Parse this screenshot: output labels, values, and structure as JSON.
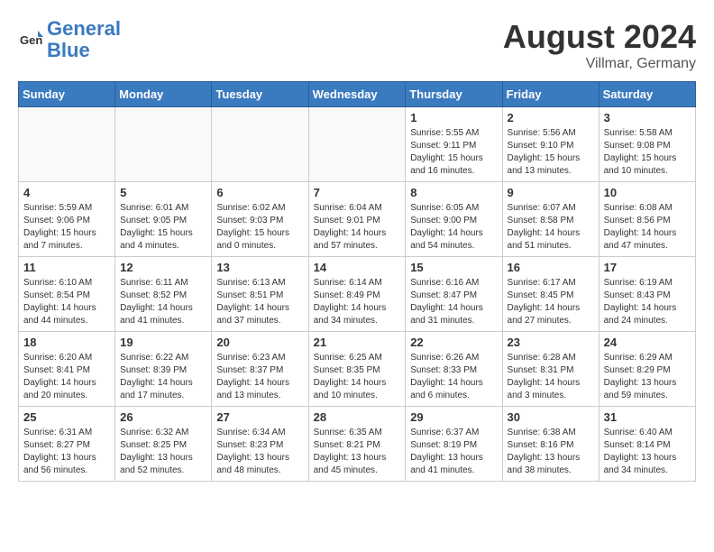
{
  "header": {
    "logo_line1": "General",
    "logo_line2": "Blue",
    "month_year": "August 2024",
    "location": "Villmar, Germany"
  },
  "days_of_week": [
    "Sunday",
    "Monday",
    "Tuesday",
    "Wednesday",
    "Thursday",
    "Friday",
    "Saturday"
  ],
  "weeks": [
    [
      {
        "day": "",
        "info": ""
      },
      {
        "day": "",
        "info": ""
      },
      {
        "day": "",
        "info": ""
      },
      {
        "day": "",
        "info": ""
      },
      {
        "day": "1",
        "info": "Sunrise: 5:55 AM\nSunset: 9:11 PM\nDaylight: 15 hours\nand 16 minutes."
      },
      {
        "day": "2",
        "info": "Sunrise: 5:56 AM\nSunset: 9:10 PM\nDaylight: 15 hours\nand 13 minutes."
      },
      {
        "day": "3",
        "info": "Sunrise: 5:58 AM\nSunset: 9:08 PM\nDaylight: 15 hours\nand 10 minutes."
      }
    ],
    [
      {
        "day": "4",
        "info": "Sunrise: 5:59 AM\nSunset: 9:06 PM\nDaylight: 15 hours\nand 7 minutes."
      },
      {
        "day": "5",
        "info": "Sunrise: 6:01 AM\nSunset: 9:05 PM\nDaylight: 15 hours\nand 4 minutes."
      },
      {
        "day": "6",
        "info": "Sunrise: 6:02 AM\nSunset: 9:03 PM\nDaylight: 15 hours\nand 0 minutes."
      },
      {
        "day": "7",
        "info": "Sunrise: 6:04 AM\nSunset: 9:01 PM\nDaylight: 14 hours\nand 57 minutes."
      },
      {
        "day": "8",
        "info": "Sunrise: 6:05 AM\nSunset: 9:00 PM\nDaylight: 14 hours\nand 54 minutes."
      },
      {
        "day": "9",
        "info": "Sunrise: 6:07 AM\nSunset: 8:58 PM\nDaylight: 14 hours\nand 51 minutes."
      },
      {
        "day": "10",
        "info": "Sunrise: 6:08 AM\nSunset: 8:56 PM\nDaylight: 14 hours\nand 47 minutes."
      }
    ],
    [
      {
        "day": "11",
        "info": "Sunrise: 6:10 AM\nSunset: 8:54 PM\nDaylight: 14 hours\nand 44 minutes."
      },
      {
        "day": "12",
        "info": "Sunrise: 6:11 AM\nSunset: 8:52 PM\nDaylight: 14 hours\nand 41 minutes."
      },
      {
        "day": "13",
        "info": "Sunrise: 6:13 AM\nSunset: 8:51 PM\nDaylight: 14 hours\nand 37 minutes."
      },
      {
        "day": "14",
        "info": "Sunrise: 6:14 AM\nSunset: 8:49 PM\nDaylight: 14 hours\nand 34 minutes."
      },
      {
        "day": "15",
        "info": "Sunrise: 6:16 AM\nSunset: 8:47 PM\nDaylight: 14 hours\nand 31 minutes."
      },
      {
        "day": "16",
        "info": "Sunrise: 6:17 AM\nSunset: 8:45 PM\nDaylight: 14 hours\nand 27 minutes."
      },
      {
        "day": "17",
        "info": "Sunrise: 6:19 AM\nSunset: 8:43 PM\nDaylight: 14 hours\nand 24 minutes."
      }
    ],
    [
      {
        "day": "18",
        "info": "Sunrise: 6:20 AM\nSunset: 8:41 PM\nDaylight: 14 hours\nand 20 minutes."
      },
      {
        "day": "19",
        "info": "Sunrise: 6:22 AM\nSunset: 8:39 PM\nDaylight: 14 hours\nand 17 minutes."
      },
      {
        "day": "20",
        "info": "Sunrise: 6:23 AM\nSunset: 8:37 PM\nDaylight: 14 hours\nand 13 minutes."
      },
      {
        "day": "21",
        "info": "Sunrise: 6:25 AM\nSunset: 8:35 PM\nDaylight: 14 hours\nand 10 minutes."
      },
      {
        "day": "22",
        "info": "Sunrise: 6:26 AM\nSunset: 8:33 PM\nDaylight: 14 hours\nand 6 minutes."
      },
      {
        "day": "23",
        "info": "Sunrise: 6:28 AM\nSunset: 8:31 PM\nDaylight: 14 hours\nand 3 minutes."
      },
      {
        "day": "24",
        "info": "Sunrise: 6:29 AM\nSunset: 8:29 PM\nDaylight: 13 hours\nand 59 minutes."
      }
    ],
    [
      {
        "day": "25",
        "info": "Sunrise: 6:31 AM\nSunset: 8:27 PM\nDaylight: 13 hours\nand 56 minutes."
      },
      {
        "day": "26",
        "info": "Sunrise: 6:32 AM\nSunset: 8:25 PM\nDaylight: 13 hours\nand 52 minutes."
      },
      {
        "day": "27",
        "info": "Sunrise: 6:34 AM\nSunset: 8:23 PM\nDaylight: 13 hours\nand 48 minutes."
      },
      {
        "day": "28",
        "info": "Sunrise: 6:35 AM\nSunset: 8:21 PM\nDaylight: 13 hours\nand 45 minutes."
      },
      {
        "day": "29",
        "info": "Sunrise: 6:37 AM\nSunset: 8:19 PM\nDaylight: 13 hours\nand 41 minutes."
      },
      {
        "day": "30",
        "info": "Sunrise: 6:38 AM\nSunset: 8:16 PM\nDaylight: 13 hours\nand 38 minutes."
      },
      {
        "day": "31",
        "info": "Sunrise: 6:40 AM\nSunset: 8:14 PM\nDaylight: 13 hours\nand 34 minutes."
      }
    ]
  ]
}
